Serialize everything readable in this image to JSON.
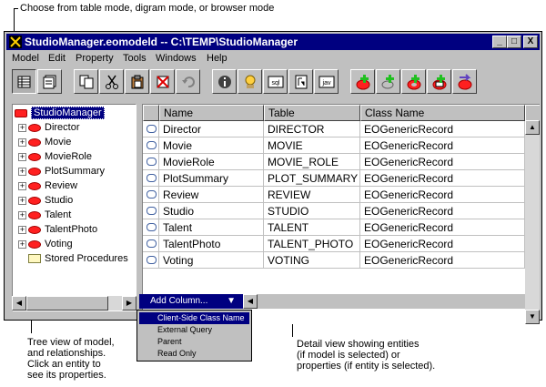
{
  "callouts": {
    "top": "Choose from table mode, digram mode, or browser mode",
    "tree": [
      "Tree view of model,",
      "and relationships.",
      "Click an entity to",
      "see its properties."
    ],
    "detail": [
      "Detail view showing entities",
      "(if model is selected) or",
      "properties (if entity is selected)."
    ]
  },
  "window": {
    "title": "StudioManager.eomodeld -- C:\\TEMP\\StudioManager",
    "controls": [
      "_",
      "□",
      "X"
    ]
  },
  "menu": [
    "Model",
    "Edit",
    "Property",
    "Tools",
    "Windows",
    "Help"
  ],
  "toolbar": {
    "icons": [
      "table-mode-icon",
      "diagram-mode-icon",
      "copy-icon",
      "cut-icon",
      "paste-icon",
      "delete-icon",
      "undo-icon",
      "inspector-icon",
      "user-icon",
      "sql-icon",
      "generate-icon",
      "java-icon",
      "add-entity-icon",
      "add-attribute-icon",
      "add-relationship-icon",
      "add-procedure-icon",
      "add-fetch-icon"
    ],
    "labels": {
      "sql": "sql",
      "java": "jav"
    }
  },
  "tree": {
    "root": "StudioManager",
    "entities": [
      "Director",
      "Movie",
      "MovieRole",
      "PlotSummary",
      "Review",
      "Studio",
      "Talent",
      "TalentPhoto",
      "Voting"
    ],
    "stored": "Stored Procedures"
  },
  "table": {
    "columns": [
      "Name",
      "Table",
      "Class Name"
    ],
    "rows": [
      [
        "Director",
        "DIRECTOR",
        "EOGenericRecord"
      ],
      [
        "Movie",
        "MOVIE",
        "EOGenericRecord"
      ],
      [
        "MovieRole",
        "MOVIE_ROLE",
        "EOGenericRecord"
      ],
      [
        "PlotSummary",
        "PLOT_SUMMARY",
        "EOGenericRecord"
      ],
      [
        "Review",
        "REVIEW",
        "EOGenericRecord"
      ],
      [
        "Studio",
        "STUDIO",
        "EOGenericRecord"
      ],
      [
        "Talent",
        "TALENT",
        "EOGenericRecord"
      ],
      [
        "TalentPhoto",
        "TALENT_PHOTO",
        "EOGenericRecord"
      ],
      [
        "Voting",
        "VOTING",
        "EOGenericRecord"
      ]
    ]
  },
  "add_column": {
    "label": "Add Column...",
    "options": [
      "Client-Side Class Name",
      "External Query",
      "Parent",
      "Read Only"
    ],
    "selected": "Client-Side Class Name"
  }
}
